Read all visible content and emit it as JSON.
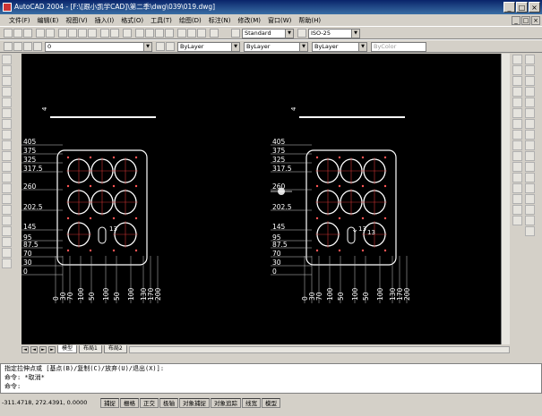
{
  "window": {
    "title": "AutoCAD 2004 - [F:\\[跟小凯学CAD]\\第二季\\dwg\\039\\019.dwg]",
    "minimize": "_",
    "maximize": "□",
    "close": "×"
  },
  "menu": [
    "文件(F)",
    "编辑(E)",
    "视图(V)",
    "插入(I)",
    "格式(O)",
    "工具(T)",
    "绘图(D)",
    "标注(N)",
    "修改(M)",
    "窗口(W)",
    "帮助(H)"
  ],
  "toolbar": {
    "text_style": "Standard",
    "dim_style": "ISO-25"
  },
  "properties": {
    "layer": "0",
    "color": "ByLayer",
    "linetype": "ByLayer",
    "lineweight": "ByLayer",
    "plotstyle": "ByColor"
  },
  "drawing": {
    "y_labels": [
      "405",
      "375",
      "325",
      "317.5",
      "260",
      "202.5",
      "145",
      "95",
      "87.5",
      "70",
      "30",
      "0"
    ],
    "x_labels": [
      "0",
      "30",
      "70",
      "100",
      "50",
      "100",
      "50",
      "100",
      "130",
      "170",
      "200"
    ],
    "callout_y": "Y",
    "callout_13": "13",
    "callout_4": "4",
    "callout_13_b": "13"
  },
  "tabs": {
    "model": "模型",
    "layout1": "布局1",
    "layout2": "布局2"
  },
  "command": {
    "line1": "指定拉伸点或 [基点(B)/复制(C)/放弃(U)/退出(X)]:",
    "line2": "命令: *取消*",
    "line3": "命令:"
  },
  "status": {
    "coords": "-311.4718, 272.4391, 0.0000",
    "toggles": [
      "捕捉",
      "栅格",
      "正交",
      "极轴",
      "对象捕捉",
      "对象追踪",
      "线宽",
      "模型"
    ]
  }
}
